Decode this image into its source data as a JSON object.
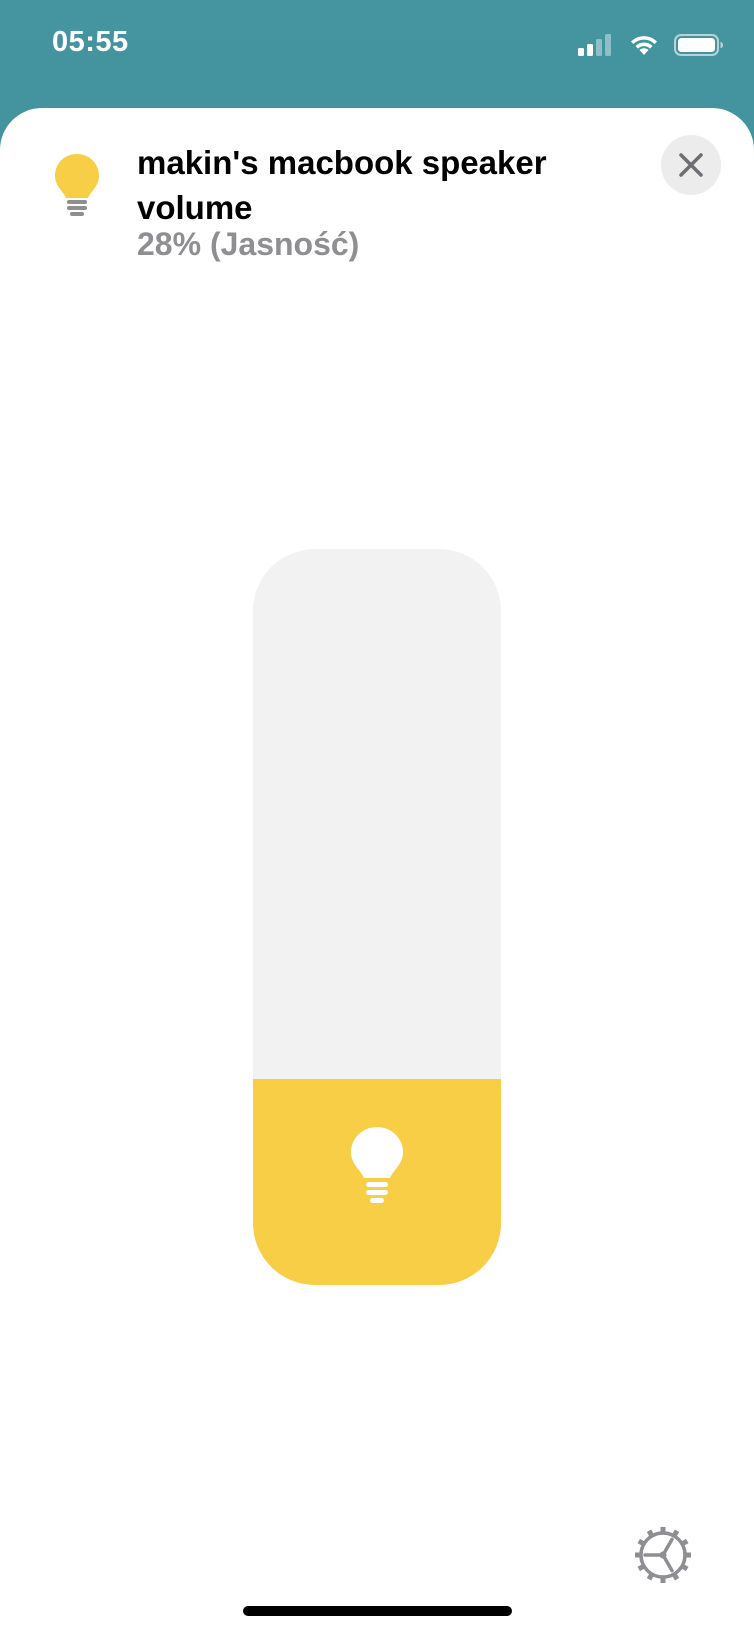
{
  "status_bar": {
    "time": "05:55",
    "icons": [
      "cellular-signal-icon",
      "wifi-icon",
      "battery-icon"
    ]
  },
  "accessory": {
    "icon": "lightbulb-icon",
    "name": "makin's macbook speaker volume",
    "state": "28% (Jasność)"
  },
  "slider": {
    "level_percent": 28,
    "icon": "lightbulb-icon"
  },
  "colors": {
    "accent": "#f7ce46",
    "track": "#f2f2f2",
    "subtitle": "#8e8e93",
    "header_bg": "#4495a0"
  },
  "buttons": {
    "close_icon": "close-icon",
    "settings_icon": "gear-icon"
  }
}
